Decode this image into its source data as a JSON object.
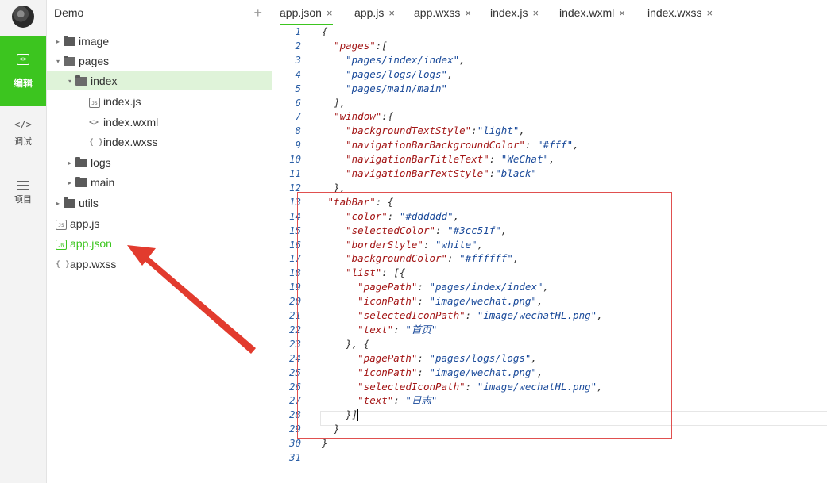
{
  "activity_bar": {
    "items": [
      {
        "label": "编辑",
        "icon": "code-icon",
        "active": true
      },
      {
        "label": "调试",
        "icon": "debug-icon",
        "active": false
      },
      {
        "label": "项目",
        "icon": "list-icon",
        "active": false
      }
    ],
    "edit_icon_glyph": "<>",
    "debug_icon_glyph": "</>"
  },
  "sidebar": {
    "project_name": "Demo",
    "add_label": "+",
    "tree": [
      {
        "name": "image",
        "type": "folder",
        "expanded": false,
        "depth": 0
      },
      {
        "name": "pages",
        "type": "folder",
        "expanded": true,
        "depth": 0
      },
      {
        "name": "index",
        "type": "folder",
        "expanded": true,
        "depth": 1
      },
      {
        "name": "index.js",
        "type": "js",
        "badge": "JS",
        "depth": 2
      },
      {
        "name": "index.wxml",
        "type": "wxml",
        "badge": "<>",
        "depth": 2
      },
      {
        "name": "index.wxss",
        "type": "wxss",
        "badge": "{ }",
        "depth": 2
      },
      {
        "name": "logs",
        "type": "folder",
        "expanded": false,
        "depth": 1
      },
      {
        "name": "main",
        "type": "folder",
        "expanded": false,
        "depth": 1
      },
      {
        "name": "utils",
        "type": "folder",
        "expanded": false,
        "depth": 0
      },
      {
        "name": "app.js",
        "type": "js",
        "badge": "JS",
        "depth": 0
      },
      {
        "name": "app.json",
        "type": "json",
        "badge": "JN",
        "depth": 0,
        "active": true
      },
      {
        "name": "app.wxss",
        "type": "wxss",
        "badge": "{ }",
        "depth": 0
      }
    ]
  },
  "editor": {
    "tabs": [
      {
        "label": "app.json",
        "close": "×",
        "active": true
      },
      {
        "label": "app.js",
        "close": "×"
      },
      {
        "label": "app.wxss",
        "close": "×"
      },
      {
        "label": "index.js",
        "close": "×"
      },
      {
        "label": "index.wxml",
        "close": "×"
      },
      {
        "label": "index.wxss",
        "close": "×"
      }
    ],
    "lines": [
      {
        "n": "1",
        "text": "{"
      },
      {
        "n": "2",
        "text": "  \"pages\":["
      },
      {
        "n": "3",
        "text": "    \"pages/index/index\","
      },
      {
        "n": "4",
        "text": "    \"pages/logs/logs\","
      },
      {
        "n": "5",
        "text": "    \"pages/main/main\""
      },
      {
        "n": "6",
        "text": "  ],"
      },
      {
        "n": "7",
        "text": "  \"window\":{"
      },
      {
        "n": "8",
        "text": "    \"backgroundTextStyle\":\"light\","
      },
      {
        "n": "9",
        "text": "    \"navigationBarBackgroundColor\": \"#fff\","
      },
      {
        "n": "10",
        "text": "    \"navigationBarTitleText\": \"WeChat\","
      },
      {
        "n": "11",
        "text": "    \"navigationBarTextStyle\":\"black\""
      },
      {
        "n": "12",
        "text": "  },"
      },
      {
        "n": "13",
        "text": " \"tabBar\": {"
      },
      {
        "n": "14",
        "text": "    \"color\": \"#dddddd\","
      },
      {
        "n": "15",
        "text": "    \"selectedColor\": \"#3cc51f\","
      },
      {
        "n": "16",
        "text": "    \"borderStyle\": \"white\","
      },
      {
        "n": "17",
        "text": "    \"backgroundColor\": \"#ffffff\","
      },
      {
        "n": "18",
        "text": "    \"list\": [{"
      },
      {
        "n": "19",
        "text": "      \"pagePath\": \"pages/index/index\","
      },
      {
        "n": "20",
        "text": "      \"iconPath\": \"image/wechat.png\","
      },
      {
        "n": "21",
        "text": "      \"selectedIconPath\": \"image/wechatHL.png\","
      },
      {
        "n": "22",
        "text": "      \"text\": \"首页\""
      },
      {
        "n": "23",
        "text": "    }, {"
      },
      {
        "n": "24",
        "text": "      \"pagePath\": \"pages/logs/logs\","
      },
      {
        "n": "25",
        "text": "      \"iconPath\": \"image/wechat.png\","
      },
      {
        "n": "26",
        "text": "      \"selectedIconPath\": \"image/wechatHL.png\","
      },
      {
        "n": "27",
        "text": "      \"text\": \"日志\""
      },
      {
        "n": "28",
        "text": "    }]"
      },
      {
        "n": "29",
        "text": "  }"
      },
      {
        "n": "30",
        "text": "}"
      },
      {
        "n": "31",
        "text": ""
      }
    ]
  },
  "colors": {
    "accent": "#3cc51f",
    "annotation": "#e23b2e",
    "key": "#a31515",
    "string": "#1a4a9a",
    "line_number": "#2b5fa6"
  }
}
